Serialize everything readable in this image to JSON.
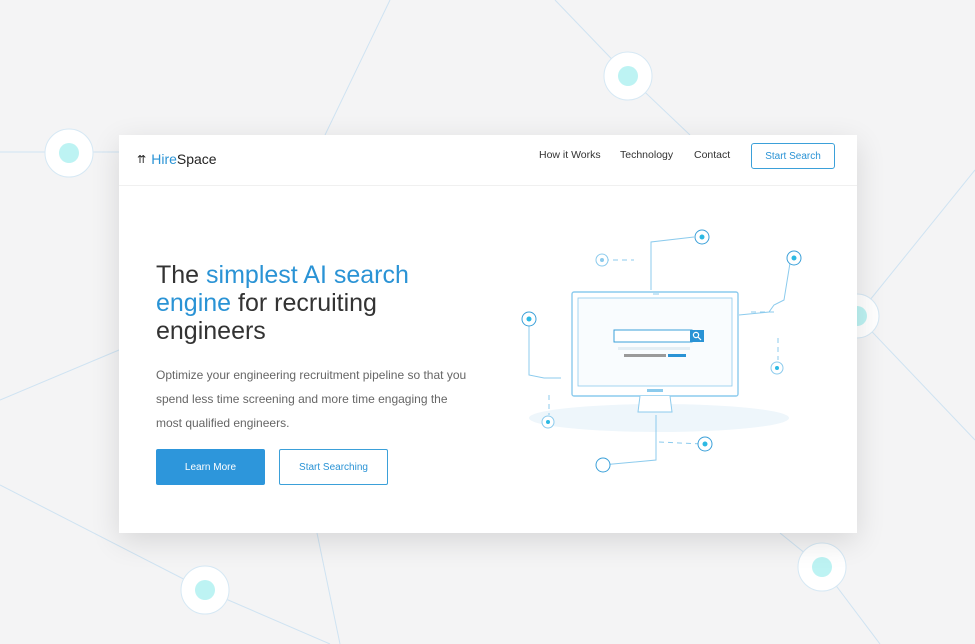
{
  "nav": {
    "logo_prefix": "Hire",
    "logo_suffix": "Space",
    "links": [
      "How it Works",
      "Technology",
      "Contact"
    ],
    "cta": "Start Search"
  },
  "hero": {
    "headline_part1": "The ",
    "headline_highlight1": "simplest AI search engine",
    "headline_part2": " for recruiting engineers",
    "description": "Optimize your engineering recruitment pipeline so that you spend less time screening and more time engaging the most qualified engineers.",
    "primary_button": "Learn More",
    "secondary_button": "Start Searching"
  },
  "colors": {
    "accent": "#2a93d5",
    "node": "#bdf3f3",
    "background": "#f4f4f5"
  },
  "icons": {
    "logo": "double-pin-icon",
    "search": "search-icon"
  }
}
